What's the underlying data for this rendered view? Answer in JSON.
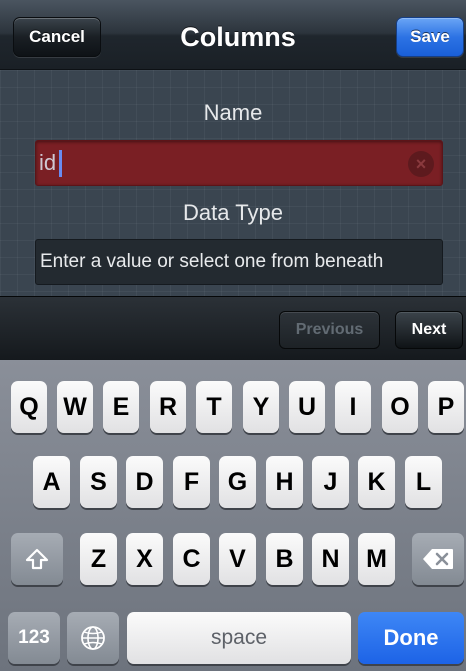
{
  "navbar": {
    "cancel_label": "Cancel",
    "title": "Columns",
    "save_label": "Save"
  },
  "form": {
    "name_label": "Name",
    "name_value": "id",
    "data_type_label": "Data Type",
    "data_type_placeholder": "Enter a value or select one from beneath"
  },
  "accessory": {
    "previous_label": "Previous",
    "next_label": "Next"
  },
  "keyboard": {
    "row1": [
      "Q",
      "W",
      "E",
      "R",
      "T",
      "Y",
      "U",
      "I",
      "O",
      "P"
    ],
    "row2": [
      "A",
      "S",
      "D",
      "F",
      "G",
      "H",
      "J",
      "K",
      "L"
    ],
    "row3": [
      "Z",
      "X",
      "C",
      "V",
      "B",
      "N",
      "M"
    ],
    "numbers_label": "123",
    "space_label": "space",
    "done_label": "Done"
  },
  "icons": {
    "clear": "clear-icon",
    "shift": "shift-icon",
    "backspace": "backspace-icon",
    "globe": "globe-icon"
  },
  "colors": {
    "accent_blue": "#2d73e4",
    "error_field": "#7a1f24"
  }
}
